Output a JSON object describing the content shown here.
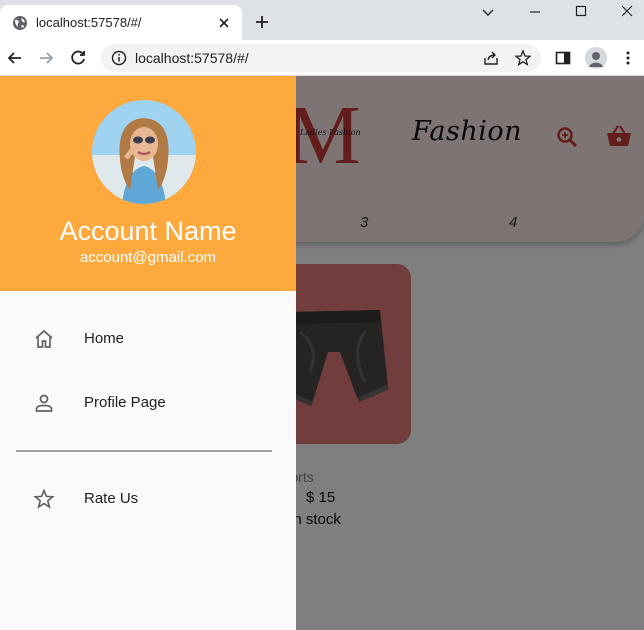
{
  "browser": {
    "tab_title": "localhost:57578/#/",
    "url": "localhost:57578/#/"
  },
  "app": {
    "logo_letter": "M",
    "logo_subtext": "Ladies Fashion",
    "brand_name": "Fashion",
    "accent_color": "#c93a3a",
    "header_bg": "#fbe9e6",
    "tab_numbers": [
      "3",
      "4"
    ],
    "product": {
      "name": "rey Shorts",
      "price": "$ 15",
      "stock": "ducts in stock",
      "card_color": "#e27a7a"
    }
  },
  "drawer": {
    "header_color": "#fda93d",
    "account_name": "Account Name",
    "account_email": "account@gmail.com",
    "items": [
      {
        "label": "Home",
        "icon": "home-icon"
      },
      {
        "label": "Profile Page",
        "icon": "person-icon"
      },
      {
        "label": "Rate Us",
        "icon": "star-icon"
      }
    ]
  }
}
